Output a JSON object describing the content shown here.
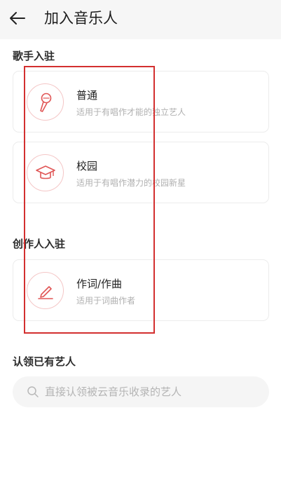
{
  "header": {
    "title": "加入音乐人"
  },
  "sections": [
    {
      "title": "歌手入驻",
      "cards": [
        {
          "title": "普通",
          "desc": "适用于有唱作才能的独立艺人",
          "icon": "microphone-icon"
        },
        {
          "title": "校园",
          "desc": "适用于有唱作潜力的校园新星",
          "icon": "graduation-cap-icon"
        }
      ]
    },
    {
      "title": "创作人入驻",
      "cards": [
        {
          "title": "作词/作曲",
          "desc": "适用于词曲作者",
          "icon": "pen-icon"
        }
      ]
    },
    {
      "title": "认领已有艺人"
    }
  ],
  "search": {
    "placeholder": "直接认领被云音乐收录的艺人"
  },
  "colors": {
    "accent": "#e05555",
    "icon_border": "#f4c6c6",
    "highlight": "#d32f2f"
  }
}
